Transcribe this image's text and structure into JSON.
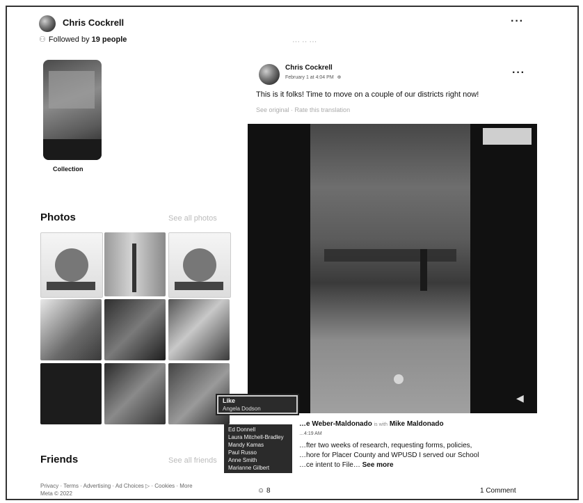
{
  "profile": {
    "name": "Chris Cockrell",
    "followed_prefix": "Followed by ",
    "followed_count": "19 people"
  },
  "collection": {
    "label": "Collection"
  },
  "photos": {
    "title": "Photos",
    "see_all": "See all photos"
  },
  "friends": {
    "title": "Friends",
    "see_all": "See all friends"
  },
  "post": {
    "author": "Chris Cockrell",
    "meta": "February 1 at 4:04 PM",
    "text": "This is it folks! Time to move on a couple of our districts right now!",
    "subtext": "See original · Rate this translation"
  },
  "comment": {
    "author": "…e Weber-Maldonado",
    "with": "is with",
    "tagged": "Mike Maldonado",
    "time": "…4:19 AM",
    "line1": "…fter two weeks of research, requesting forms, policies,",
    "line2": "…hore for Placer County and WPUSD I served our School",
    "line3": "…ce intent to File…",
    "see_more": "See more"
  },
  "reaction_menu": {
    "title": "Like",
    "highlight": "Angela Dodson",
    "items": [
      "Ed Donnell",
      "Laura Mitchell-Bradley",
      "Mandy Kamas",
      "Paul Russo",
      "Anne Smith",
      "Marianne Gilbert"
    ]
  },
  "footer": {
    "links": "Privacy · Terms · Advertising · Ad Choices ▷ · Cookies · More",
    "copyright": "Meta © 2022",
    "reactions_count": "8",
    "comments_count": "1 Comment"
  },
  "header_faded": "··· ·· ···",
  "colors": {
    "menu_bg": "#2b2b2b",
    "video_bg": "#111111"
  }
}
